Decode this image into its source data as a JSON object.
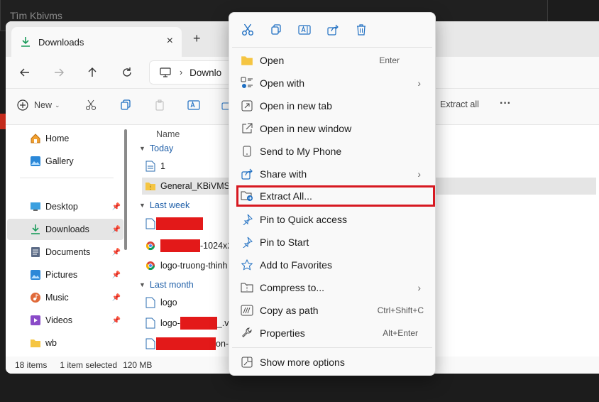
{
  "background": {
    "title": "Tìm Kbivms"
  },
  "window": {
    "tab_label": "Downloads",
    "tab_close": "×",
    "new_tab": "+",
    "address": "Downlo",
    "address_chevron": "›"
  },
  "toolbar": {
    "new_label": "New",
    "new_dropdown": "⌄",
    "extract_all_label": "Extract all",
    "more": "···"
  },
  "sidebar": {
    "items": [
      {
        "label": "Home"
      },
      {
        "label": "Gallery"
      },
      {
        "label": "Desktop"
      },
      {
        "label": "Downloads"
      },
      {
        "label": "Documents"
      },
      {
        "label": "Pictures"
      },
      {
        "label": "Music"
      },
      {
        "label": "Videos"
      },
      {
        "label": "wb"
      }
    ]
  },
  "filelist": {
    "column_name": "Name",
    "groups": [
      "Today",
      "Last week",
      "Last month"
    ],
    "rows": [
      {
        "label": "1"
      },
      {
        "label": "General_KBiVMS-V"
      },
      {
        "label": ""
      },
      {
        "label": "-1024x2"
      },
      {
        "label": "logo-truong-thinh"
      },
      {
        "label": "logo"
      },
      {
        "label": "logo-",
        "suffix": "_.vi"
      },
      {
        "label": "",
        "suffix": "on-1"
      }
    ]
  },
  "status": {
    "count": "18 items",
    "selected": "1 item selected",
    "size": "120 MB"
  },
  "context_menu": {
    "items": [
      {
        "label": "Open",
        "shortcut": "Enter"
      },
      {
        "label": "Open with",
        "arrow": "›"
      },
      {
        "label": "Open in new tab"
      },
      {
        "label": "Open in new window"
      },
      {
        "label": "Send to My Phone"
      },
      {
        "label": "Share with",
        "arrow": "›"
      },
      {
        "label": "Extract All..."
      },
      {
        "label": "Pin to Quick access"
      },
      {
        "label": "Pin to Start"
      },
      {
        "label": "Add to Favorites"
      },
      {
        "label": "Compress to...",
        "arrow": "›"
      },
      {
        "label": "Copy as path",
        "shortcut": "Ctrl+Shift+C"
      },
      {
        "label": "Properties",
        "shortcut": "Alt+Enter"
      },
      {
        "label": "Show more options"
      }
    ]
  },
  "colors": {
    "accent": "#0067c0",
    "highlight_border": "#d71921",
    "redaction": "#e31919"
  }
}
